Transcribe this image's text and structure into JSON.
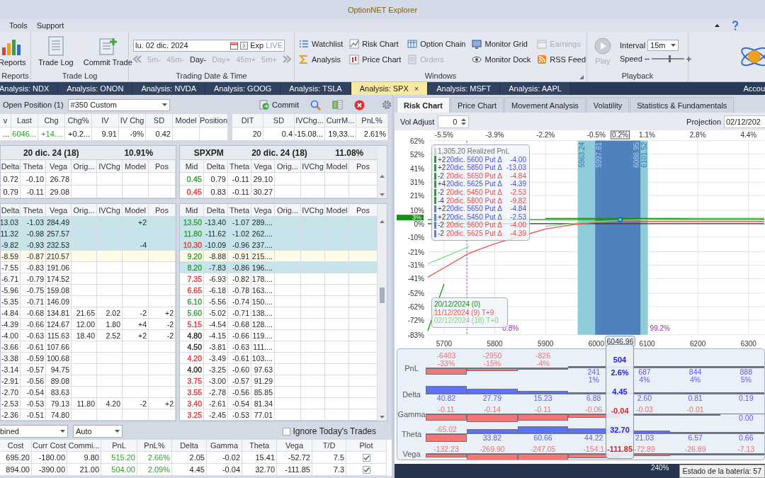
{
  "window": {
    "title": "OptionNET Explorer"
  },
  "menu": [
    {
      "label": "Tools"
    },
    {
      "label": "Support"
    }
  ],
  "ribbon": {
    "reports": {
      "button": "Reports",
      "label": "Reports"
    },
    "trade_log": {
      "buttons": [
        "Trade Log",
        "Commit Trade"
      ],
      "label": "Trade Log"
    },
    "trading_date": {
      "date": "lu. 02 dic. 2024",
      "exp": "Exp",
      "live": "LIVE",
      "label": "Trading Date & Time",
      "steps": [
        {
          "label": "5m-",
          "disabled": true
        },
        {
          "label": "45m-",
          "disabled": true
        },
        {
          "label": "Day-",
          "disabled": false
        },
        {
          "label": "Day+",
          "disabled": true
        },
        {
          "label": "45m+",
          "disabled": true
        },
        {
          "label": "5m+",
          "disabled": true
        }
      ]
    },
    "windows": {
      "label": "Windows",
      "buttons": [
        {
          "label": "Watchlist",
          "disabled": false
        },
        {
          "label": "Analysis",
          "disabled": false
        },
        {
          "label": "Risk Chart",
          "disabled": false
        },
        {
          "label": "Price Chart",
          "disabled": false
        },
        {
          "label": "Option Chain",
          "disabled": false
        },
        {
          "label": "Orders",
          "disabled": true
        },
        {
          "label": "Monitor Grid",
          "disabled": false
        },
        {
          "label": "Monitor Dock",
          "disabled": false
        },
        {
          "label": "Earnings",
          "disabled": true
        },
        {
          "label": "RSS Feed",
          "disabled": false
        }
      ]
    },
    "playback": {
      "label": "Playback",
      "play": {
        "label": "Play",
        "disabled": true
      },
      "interval_label": "Interval",
      "interval": "15m",
      "speed_label": "Speed",
      "speed": {
        "level": 0.55
      }
    }
  },
  "doc_tabs": [
    {
      "label": "Analysis: NDX",
      "selected": false
    },
    {
      "label": "Analysis: ONON",
      "selected": false
    },
    {
      "label": "Analysis: NVDA",
      "selected": false
    },
    {
      "label": "Analysis: GOOG",
      "selected": false
    },
    {
      "label": "Analysis: TSLA",
      "selected": false
    },
    {
      "label": "Analysis: SPX",
      "selected": true,
      "close": "×"
    },
    {
      "label": "Analysis: MSFT",
      "selected": false
    },
    {
      "label": "Analysis: AAPL",
      "selected": false
    }
  ],
  "account_tab": "Accou",
  "position_bar": {
    "label": "Open Position (1)",
    "position": "#350 Custom",
    "commit": "Commit"
  },
  "underlying": {
    "columns": [
      "v",
      "Last",
      "Chg",
      "Chg%",
      "IV",
      "IV Chg",
      "SD",
      "Model",
      "Position"
    ],
    "cells": [
      {
        "text": "..."
      },
      {
        "text": "6046...",
        "color": "#2e9e2e"
      },
      {
        "text": "+14....",
        "color": "#2e9e2e"
      },
      {
        "text": "+0.2..."
      },
      {
        "text": "9.91"
      },
      {
        "text": "-9%"
      },
      {
        "text": "0.42"
      },
      null,
      null
    ],
    "summary_columns": [
      "DIT",
      "SD",
      "IVChg...",
      "CurrM...",
      "PnL%"
    ],
    "summary_cells": [
      "20",
      "0.4",
      "-15.08...",
      "19,33...",
      "2.61%"
    ]
  },
  "chain_top": {
    "left_header": {
      "expiry": "20 dic. 24 (18)",
      "iv": "10.91%"
    },
    "right_header": {
      "symbol": "SPXPM",
      "expiry": "20 dic. 24 (18)",
      "iv": "11.08%"
    },
    "left_columns": [
      "Delta",
      "Theta",
      "Vega",
      "Orig...",
      "IVChg",
      "Model",
      "Pos"
    ],
    "right_columns": [
      "Mid",
      "Delta",
      "Theta",
      "Vega",
      "Orig...",
      "IVChg",
      "Model",
      "Pos"
    ],
    "rows": [
      {
        "left": {
          "cells": [
            "0.72",
            "-0.10",
            "26.78",
            null,
            null,
            null,
            null
          ]
        },
        "right": {
          "mid": {
            "text": "0.45",
            "color": "#2e9e2e"
          },
          "cells": [
            "0.79",
            "-0.11",
            "29.10",
            null,
            null,
            null,
            null
          ]
        }
      },
      {
        "left": {
          "cells": [
            "0.79",
            "-0.11",
            "29.08",
            null,
            null,
            null,
            null
          ]
        },
        "right": {
          "mid": {
            "text": "0.45",
            "color": "#f03030"
          },
          "cells": [
            "0.83",
            "-0.11",
            "30.27",
            null,
            null,
            null,
            null
          ]
        }
      }
    ]
  },
  "chain_bottom": {
    "left_columns": [
      "Delta",
      "Theta",
      "Vega",
      "Orig...",
      "IVChg",
      "Model",
      "Pos"
    ],
    "right_columns": [
      "Mid",
      "Delta",
      "Theta",
      "Vega",
      "Orig...",
      "IVChg",
      "Model",
      "Pos"
    ],
    "rows": [
      {
        "left": {
          "kind": "position",
          "cells": [
            "13.03",
            "-1.03",
            "284.49",
            null,
            null,
            "+2",
            null
          ]
        },
        "right": {
          "kind": "position",
          "mid": {
            "text": "13.50",
            "color": "#2e9e2e"
          },
          "cells": [
            "-13.40",
            "-1.07",
            "289....",
            null,
            null,
            null,
            null
          ]
        }
      },
      {
        "left": {
          "kind": "position",
          "cells": [
            "11.32",
            "-0.98",
            "257.57",
            null,
            null,
            null,
            null
          ]
        },
        "right": {
          "kind": "position",
          "mid": {
            "text": "11.80",
            "color": "#2e9e2e"
          },
          "cells": [
            "-11.62",
            "-1.02",
            "262....",
            null,
            null,
            null,
            null
          ]
        }
      },
      {
        "left": {
          "kind": "position",
          "cells": [
            "-9.82",
            "-0.93",
            "232.53",
            null,
            null,
            "-4",
            null
          ]
        },
        "right": {
          "kind": "position",
          "mid": {
            "text": "10.30",
            "color": "#f03030"
          },
          "cells": [
            "-10.09",
            "-0.96",
            "237....",
            null,
            null,
            null,
            null
          ]
        }
      },
      {
        "left": {
          "kind": "atm",
          "cells": [
            "-8.59",
            "-0.87",
            "210.57",
            null,
            null,
            null,
            null
          ]
        },
        "right": {
          "kind": "atm",
          "mid": {
            "text": "9.20",
            "color": "#2e9e2e"
          },
          "cells": [
            "-8.88",
            "-0.91",
            "215....",
            null,
            null,
            null,
            null
          ]
        }
      },
      {
        "left": {
          "kind": "plain",
          "cells": [
            "-7.55",
            "-0.83",
            "191.06",
            null,
            null,
            null,
            null
          ]
        },
        "right": {
          "kind": "position",
          "mid": {
            "text": "8.20",
            "color": "#2e9e2e"
          },
          "cells": [
            "-7.83",
            "-0.86",
            "196....",
            null,
            null,
            null,
            null
          ]
        }
      },
      {
        "left": {
          "kind": "plain",
          "cells": [
            "-6.71",
            "-0.79",
            "174.52",
            null,
            null,
            null,
            null
          ]
        },
        "right": {
          "kind": "plain",
          "mid": {
            "text": "7.35",
            "color": "#f03030"
          },
          "cells": [
            "-6.93",
            "-0.82",
            "178....",
            null,
            null,
            null,
            null
          ]
        }
      },
      {
        "left": {
          "kind": "plain",
          "cells": [
            "-5.96",
            "-0.75",
            "159.08",
            null,
            null,
            null,
            null
          ]
        },
        "right": {
          "kind": "plain",
          "mid": {
            "text": "6.65",
            "color": "#f03030"
          },
          "cells": [
            "-6.18",
            "-0.78",
            "163....",
            null,
            null,
            null,
            null
          ]
        }
      },
      {
        "left": {
          "kind": "plain",
          "cells": [
            "-5.35",
            "-0.71",
            "146.09",
            null,
            null,
            null,
            null
          ]
        },
        "right": {
          "kind": "plain",
          "mid": {
            "text": "6.10",
            "color": "#2e9e2e"
          },
          "cells": [
            "-5.56",
            "-0.74",
            "150....",
            null,
            null,
            null,
            null
          ]
        }
      },
      {
        "left": {
          "kind": "plain",
          "cells": [
            "-4.84",
            "-0.68",
            "134.81",
            "21.65",
            "2.02",
            "-2",
            "+2"
          ]
        },
        "right": {
          "kind": "plain",
          "mid": {
            "text": "5.60",
            "color": "#2e9e2e"
          },
          "cells": [
            "-5.02",
            "-0.71",
            "138....",
            null,
            null,
            null,
            null
          ]
        }
      },
      {
        "left": {
          "kind": "plain",
          "cells": [
            "-4.39",
            "-0.66",
            "124.67",
            "12.00",
            "1.80",
            "+4",
            "-2"
          ]
        },
        "right": {
          "kind": "plain",
          "mid": {
            "text": "5.15",
            "color": "#f03030"
          },
          "cells": [
            "-4.54",
            "-0.68",
            "128....",
            null,
            null,
            null,
            null
          ]
        }
      },
      {
        "left": {
          "kind": "plain",
          "cells": [
            "-4.00",
            "-0.63",
            "115.63",
            "18.40",
            "2.52",
            "+2",
            "-2"
          ]
        },
        "right": {
          "kind": "plain",
          "mid": {
            "text": "4.80",
            "color": "#222222"
          },
          "cells": [
            "-4.15",
            "-0.66",
            "119....",
            null,
            null,
            null,
            null
          ]
        }
      },
      {
        "left": {
          "kind": "plain",
          "cells": [
            "-3.66",
            "-0.61",
            "107.66",
            null,
            null,
            null,
            null
          ]
        },
        "right": {
          "kind": "plain",
          "mid": {
            "text": "4.50",
            "color": "#222222"
          },
          "cells": [
            "-3.81",
            "-0.63",
            "111....",
            null,
            null,
            null,
            null
          ]
        }
      },
      {
        "left": {
          "kind": "plain",
          "cells": [
            "-3.38",
            "-0.59",
            "100.68",
            null,
            null,
            null,
            null
          ]
        },
        "right": {
          "kind": "plain",
          "mid": {
            "text": "4.20",
            "color": "#f03030"
          },
          "cells": [
            "-3.49",
            "-0.61",
            "103....",
            null,
            null,
            null,
            null
          ]
        }
      },
      {
        "left": {
          "kind": "plain",
          "cells": [
            "-3.14",
            "-0.57",
            "94.75",
            null,
            null,
            null,
            null
          ]
        },
        "right": {
          "kind": "plain",
          "mid": {
            "text": "4.00",
            "color": "#222222"
          },
          "cells": [
            "-3.25",
            "-0.60",
            "97.63",
            null,
            null,
            null,
            null
          ]
        }
      },
      {
        "left": {
          "kind": "plain",
          "cells": [
            "-2.91",
            "-0.56",
            "89.08",
            null,
            null,
            null,
            null
          ]
        },
        "right": {
          "kind": "plain",
          "mid": {
            "text": "3.75",
            "color": "#f03030"
          },
          "cells": [
            "-3.00",
            "-0.57",
            "91.29",
            null,
            null,
            null,
            null
          ]
        }
      },
      {
        "left": {
          "kind": "plain",
          "cells": [
            "-2.70",
            "-0.54",
            "83.63",
            null,
            null,
            null,
            null
          ]
        },
        "right": {
          "kind": "plain",
          "mid": {
            "text": "3.55",
            "color": "#f03030"
          },
          "cells": [
            "-2.78",
            "-0.56",
            "85.85",
            null,
            null,
            null,
            null
          ]
        }
      },
      {
        "left": {
          "kind": "plain",
          "cells": [
            "-2.53",
            "-0.53",
            "79.13",
            "11.80",
            "4.20",
            "-2",
            "+2"
          ]
        },
        "right": {
          "kind": "plain",
          "mid": {
            "text": "3.40",
            "color": "#f03030"
          },
          "cells": [
            "-2.61",
            "-0.54",
            "81.34",
            null,
            null,
            null,
            null
          ]
        }
      },
      {
        "left": {
          "kind": "plain",
          "cells": [
            "-2.36",
            "-0.51",
            "74.80",
            null,
            null,
            null,
            null
          ]
        },
        "right": {
          "kind": "plain",
          "mid": {
            "text": "3.25",
            "color": "#f03030"
          },
          "cells": [
            "-2.45",
            "-0.53",
            "77.01",
            null,
            null,
            null,
            null
          ]
        }
      }
    ]
  },
  "filters": {
    "grouping": "bined",
    "mode": "Auto",
    "ignore_trades": {
      "label": "Ignore Today's Trades",
      "checked": false
    }
  },
  "summary": {
    "columns": [
      "Cost",
      "Curr Cost",
      "Commi...",
      "PnL",
      "PnL%",
      "Delta",
      "Gamma",
      "Theta",
      "Vega",
      "T/D",
      "Plot"
    ],
    "rows": [
      {
        "cells": [
          "695.20",
          "-180.00",
          "9.80",
          "515.20",
          "2.66%",
          "2.05",
          "-0.02",
          "15.41",
          "-52.72",
          "7.5"
        ],
        "plot": true
      },
      {
        "cells": [
          "894.00",
          "-390.00",
          "21.00",
          "504.00",
          "2.09%",
          "4.45",
          "-0.04",
          "32.70",
          "-111.85",
          "7.3"
        ],
        "plot": true
      }
    ]
  },
  "chart_tabs": [
    {
      "label": "Risk Chart",
      "selected": true
    },
    {
      "label": "Price Chart",
      "selected": false
    },
    {
      "label": "Movement Analysis",
      "selected": false
    },
    {
      "label": "Volatility",
      "selected": false
    },
    {
      "label": "Statistics & Fundamentals",
      "selected": false
    }
  ],
  "vol_adjust": {
    "label": "Vol Adjust",
    "value": "0"
  },
  "projection": {
    "label": "Projection",
    "value": "02/12/202"
  },
  "risk_chart": {
    "top_axis": [
      "-5.5%",
      "-3.9%",
      "-2.2%",
      "-0.5%",
      "1.1%",
      "2.8%",
      "4.4%"
    ],
    "band_labels": [
      "5963.24",
      "5997.81",
      "6086.95",
      "6101.52"
    ],
    "pnl_marker": "3%",
    "current_price": "6046.96",
    "current_percent": "0.2%",
    "probabilities": [
      "0.8%",
      "99.2%"
    ],
    "legend": [
      {
        "kind": "summary",
        "text": "1,305.20 Realized PnL",
        "color": "#707070"
      },
      {
        "kind": "leg",
        "qty": "+2",
        "contract": "20dic. 5600 Put Δ",
        "delta": "-4.00",
        "color": "#4a4af0",
        "adjustment": false
      },
      {
        "kind": "leg",
        "qty": "+2",
        "contract": "20dic. 5850 Put Δ",
        "delta": "-13.03",
        "color": "#4a4af0",
        "adjustment": false
      },
      {
        "kind": "leg",
        "qty": "-2",
        "contract": "20dic. 5650 Put Δ",
        "delta": "-4.84",
        "color": "#f04848",
        "adjustment": false
      },
      {
        "kind": "leg",
        "qty": "+4",
        "contract": "20dic. 5625 Put Δ",
        "delta": "-4.39",
        "color": "#4a4af0",
        "adjustment": false
      },
      {
        "kind": "leg",
        "qty": "-2",
        "contract": "20dic. 5450 Put Δ",
        "delta": "-2.53",
        "color": "#f04848",
        "adjustment": false
      },
      {
        "kind": "leg",
        "qty": "-4",
        "contract": "20dic. 5800 Put Δ",
        "delta": "-9.82",
        "color": "#f04848",
        "adjustment": false
      },
      {
        "kind": "leg",
        "qty": "+2",
        "contract": "20dic. 5650 Put Δ",
        "delta": "-4.84",
        "color": "#4a4af0",
        "adjustment": true
      },
      {
        "kind": "leg",
        "qty": "+2",
        "contract": "20dic. 5450 Put Δ",
        "delta": "-2.53",
        "color": "#4a4af0",
        "adjustment": true
      },
      {
        "kind": "leg",
        "qty": "-2",
        "contract": "20dic. 5600 Put Δ",
        "delta": "-4.00",
        "color": "#f04848",
        "adjustment": true
      },
      {
        "kind": "leg",
        "qty": "-2",
        "contract": "20dic. 5625 Put Δ",
        "delta": "-4.39",
        "color": "#f04848",
        "adjustment": true
      }
    ],
    "chart_data": {
      "type": "line",
      "x": [
        5668,
        5700,
        5750,
        5800,
        5900,
        5950,
        6000,
        6050,
        6100,
        6200,
        6331
      ],
      "series": [
        {
          "name": "20/12/2024 (0)",
          "color": "#1a8c1a",
          "values": [
            -80,
            -45,
            null,
            null,
            4,
            4,
            4,
            4,
            4,
            4,
            4
          ]
        },
        {
          "name": "11/12/2024 (9) T+9",
          "color": "#f05050",
          "values": [
            -40,
            -33,
            -22,
            -15,
            -4,
            -1,
            1,
            1.5,
            1.5,
            1.5,
            1.5
          ]
        },
        {
          "name": "02/12/2024 (18) T+0",
          "color": "#7fd87f",
          "values": [
            -30,
            -25,
            -17,
            null,
            -2,
            0,
            1.5,
            2.5,
            3,
            3.5,
            3.5
          ]
        }
      ],
      "xlim": [
        5668,
        6331
      ],
      "ylim": [
        -83,
        62
      ],
      "grid": true,
      "xticks": [
        5700,
        5800,
        5900,
        6000,
        6100,
        6200,
        6300
      ],
      "yticks": [
        {
          "value": 62,
          "label": "62%"
        },
        {
          "value": 52,
          "label": "52%"
        },
        {
          "value": 41,
          "label": "41%"
        },
        {
          "value": 31,
          "label": "31%"
        },
        {
          "value": 21,
          "label": "21%"
        },
        {
          "value": 10,
          "label": "10%"
        },
        {
          "value": 0,
          "label": "0%"
        },
        {
          "value": -10,
          "label": "-10%"
        },
        {
          "value": -21,
          "label": "-21%"
        },
        {
          "value": -31,
          "label": "-31%"
        },
        {
          "value": -41,
          "label": "-41%"
        },
        {
          "value": -52,
          "label": "-52%"
        },
        {
          "value": -62,
          "label": "-62%"
        },
        {
          "value": -72,
          "label": "-72%"
        },
        {
          "value": -83,
          "label": "-83%"
        }
      ],
      "bands": [
        {
          "axis": "x",
          "from": 5963.24,
          "to": 6101.52,
          "color": "#8fcbd9"
        },
        {
          "axis": "x",
          "from": 5997.81,
          "to": 6086.95,
          "color": "#4f81bd"
        }
      ],
      "ref_lines": [
        {
          "axis": "x",
          "value": 5745,
          "color": "#b040c0"
        },
        {
          "axis": "y",
          "value": 3,
          "color": "#1a8c1a"
        },
        {
          "axis": "y",
          "value": 0,
          "color": "#333333"
        }
      ]
    }
  },
  "greeks": {
    "rows": [
      {
        "label": "PnL",
        "values": [
          "-6403",
          "-2950",
          "-826",
          "241",
          "687",
          "844",
          "888"
        ],
        "percents": [
          "-33%",
          "-15%",
          "-4%",
          "1%",
          "4%",
          "4%",
          "5%"
        ],
        "current": "504",
        "current_percent": "2.6%"
      },
      {
        "label": "Delta",
        "values": [
          "40.82",
          "27.79",
          "15.23",
          "6.88",
          "2.60",
          "0.81",
          "0.19"
        ],
        "current": "4.45"
      },
      {
        "label": "Gamma",
        "values": [
          "-0.11",
          "-0.14",
          "-0.11",
          "-0.06",
          "-0.03",
          "-0.01",
          "0.00"
        ],
        "current": "-0.04"
      },
      {
        "label": "Theta",
        "values": [
          "-65.02",
          "33.82",
          "60.66",
          "44.22",
          "21.03",
          "6.57",
          "0.66"
        ],
        "current": "32.70"
      },
      {
        "label": "Vega",
        "values": [
          "-132.23",
          "-269.90",
          "-247.05",
          "-154.1",
          "-72.89",
          "-26.89",
          "-7.13"
        ],
        "current": "-111.85"
      }
    ]
  },
  "status_bar": {
    "zoom": "240%",
    "tooltip": "Estado de la batería: 57"
  }
}
